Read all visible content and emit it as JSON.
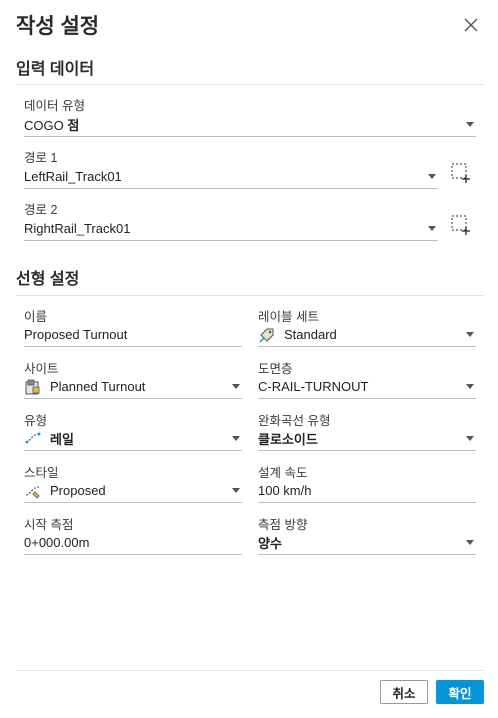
{
  "dialog": {
    "title": "작성 설정"
  },
  "input_data": {
    "heading": "입력 데이터",
    "data_type": {
      "label": "데이터 유형",
      "value_prefix": "COGO",
      "value_bold": "점"
    },
    "path1": {
      "label": "경로 1",
      "value": "LeftRail_Track01"
    },
    "path2": {
      "label": "경로 2",
      "value": "RightRail_Track01"
    }
  },
  "alignment": {
    "heading": "선형 설정",
    "name": {
      "label": "이름",
      "value": "Proposed Turnout"
    },
    "label_set": {
      "label": "레이블 세트",
      "value": "Standard"
    },
    "site": {
      "label": "사이트",
      "value": "Planned Turnout"
    },
    "layer": {
      "label": "도면층",
      "value": "C-RAIL-TURNOUT"
    },
    "type": {
      "label": "유형",
      "value": "레일"
    },
    "spiral_type": {
      "label": "완화곡선 유형",
      "value": "클로소이드"
    },
    "style": {
      "label": "스타일",
      "value": "Proposed"
    },
    "design_speed": {
      "label": "설계 속도",
      "value": "100 km/h"
    },
    "start_station": {
      "label": "시작 측점",
      "value": "0+000.00m"
    },
    "station_direction": {
      "label": "측점 방향",
      "value": "양수"
    }
  },
  "buttons": {
    "cancel": "취소",
    "ok": "확인"
  },
  "colors": {
    "primary": "#0696d7"
  }
}
